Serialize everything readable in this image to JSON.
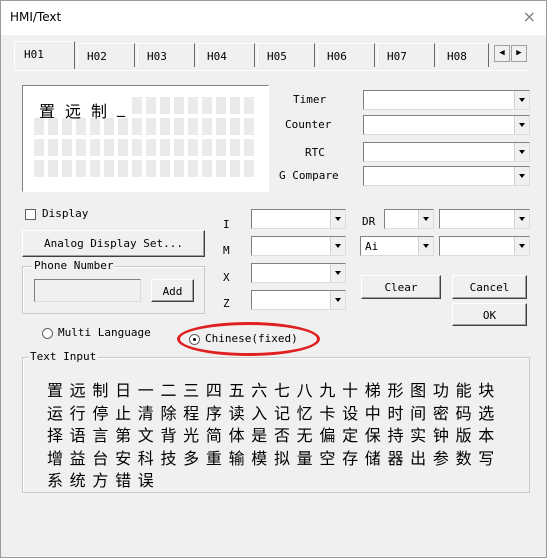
{
  "window": {
    "title": "HMI/Text",
    "close": "×"
  },
  "tabs": [
    "H01",
    "H02",
    "H03",
    "H04",
    "H05",
    "H06",
    "H07",
    "H08"
  ],
  "tab_scroll": {
    "left": "◀",
    "right": "▶"
  },
  "lcd": {
    "chars": [
      "置",
      "远",
      "制"
    ],
    "cursor": "_"
  },
  "right_fields": {
    "timer": "Timer",
    "counter": "Counter",
    "rtc": "RTC",
    "g_compare": "G Compare"
  },
  "display": {
    "checkbox_label": "Display",
    "analog_button": "Analog Display Set..."
  },
  "phone": {
    "group_label": "Phone Number",
    "add_button": "Add"
  },
  "io": {
    "i": "I",
    "m": "M",
    "x": "X",
    "z": "Z",
    "dr": "DR",
    "ai_value": "Ai"
  },
  "buttons": {
    "clear": "Clear",
    "cancel": "Cancel",
    "ok": "OK"
  },
  "language": {
    "multi": "Multi Language",
    "chinese": "Chinese(fixed)"
  },
  "text_input": {
    "group_label": "Text Input",
    "rows": [
      [
        "置",
        "远",
        "制",
        "日",
        "一",
        "二",
        "三",
        "四",
        "五",
        "六",
        "七",
        "八",
        "九",
        "十",
        "梯",
        "形",
        "图",
        "功",
        "能",
        "块"
      ],
      [
        "运",
        "行",
        "停",
        "止",
        "清",
        "除",
        "程",
        "序",
        "读",
        "入",
        "记",
        "忆",
        "卡",
        "设",
        "中",
        "时",
        "间",
        "密",
        "码",
        "选"
      ],
      [
        "择",
        "语",
        "言",
        "第",
        "文",
        "背",
        "光",
        "简",
        "体",
        "是",
        "否",
        "无",
        "偏",
        "定",
        "保",
        "持",
        "实",
        "钟",
        "版",
        "本"
      ],
      [
        "增",
        "益",
        "台",
        "安",
        "科",
        "技",
        "多",
        "重",
        "输",
        "模",
        "拟",
        "量",
        "空",
        "存",
        "储",
        "器",
        "出",
        "参",
        "数",
        "写"
      ],
      [
        "系",
        "统",
        "方",
        "错",
        "误"
      ]
    ]
  },
  "colors": {
    "dialog_bg": "#f0f0f0",
    "highlight": "#e02020"
  }
}
